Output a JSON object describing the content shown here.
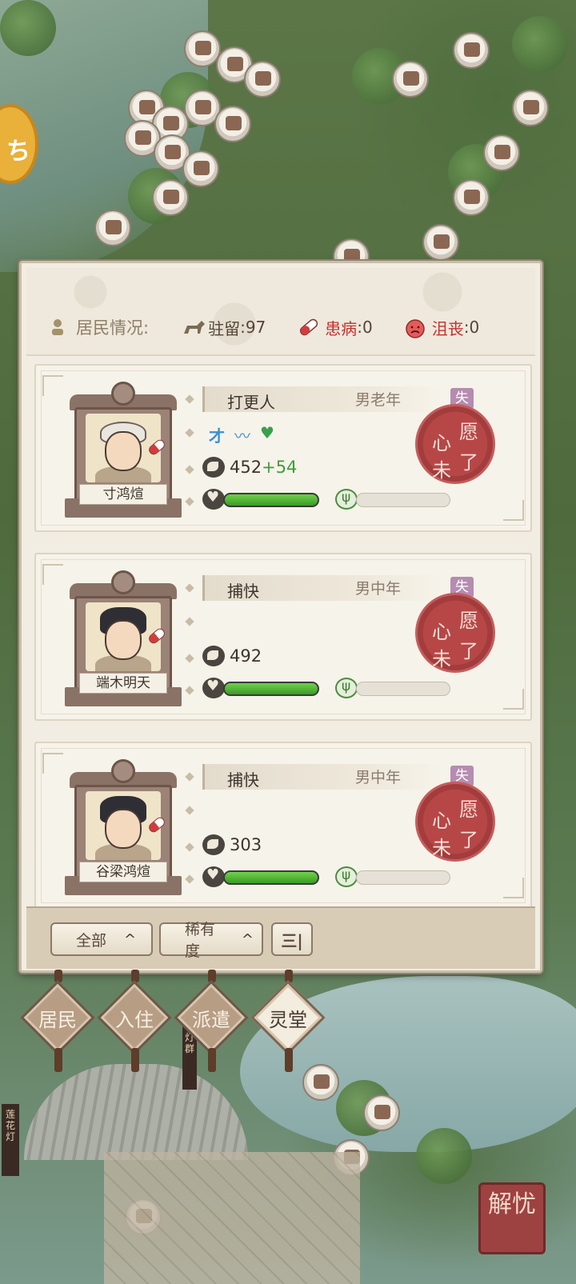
{
  "map": {
    "side_badge_glyph": "ち",
    "lamp_sign_text": "花灯群",
    "lamp_sign2_text": "莲花灯",
    "corner_button_label": "解忧"
  },
  "panel": {
    "header": {
      "residents_label": "居民情况:",
      "stationed_label": "驻留",
      "stationed_value": ":97",
      "sick_label": "患病",
      "sick_value": ":0",
      "frustrated_label": "沮丧",
      "frustrated_value": ":0"
    },
    "residents": [
      {
        "name": "寸鸿煊",
        "job": "打更人",
        "gender_age": "男老年",
        "badge": "失眠",
        "talent_1": "才",
        "talent_2": "〰",
        "talent_3": "♥",
        "power": "452",
        "power_bonus": "+54",
        "hp_fraction": 1.0,
        "xp_fraction": 0.0,
        "seal_1": "愿",
        "seal_2": "了",
        "seal_3": "心",
        "seal_4": "未",
        "portrait": "old-man"
      },
      {
        "name": "端木明天",
        "job": "捕快",
        "gender_age": "男中年",
        "badge": "失眠",
        "power": "492",
        "power_bonus": "",
        "hp_fraction": 1.0,
        "xp_fraction": 0.0,
        "seal_1": "愿",
        "seal_2": "了",
        "seal_3": "心",
        "seal_4": "未",
        "portrait": "constable"
      },
      {
        "name": "谷梁鸿煊",
        "job": "捕快",
        "gender_age": "男中年",
        "badge": "失眠",
        "power": "303",
        "power_bonus": "",
        "hp_fraction": 1.0,
        "xp_fraction": 0.0,
        "seal_1": "愿",
        "seal_2": "了",
        "seal_3": "心",
        "seal_4": "未",
        "portrait": "constable"
      }
    ],
    "footer": {
      "filter_all": "全部",
      "filter_rarity": "稀有度",
      "sort_order_glyph": "三|",
      "caret": "^"
    }
  },
  "tabs": [
    {
      "label": "居民",
      "active": false
    },
    {
      "label": "入住",
      "active": false
    },
    {
      "label": "派遣",
      "active": false
    },
    {
      "label": "灵堂",
      "active": true
    }
  ],
  "colors": {
    "panel_bg": "#f1ede2",
    "seal_red": "#b74747",
    "badge_purple": "#b68cb0",
    "hp_green": "#4fb832"
  },
  "icons": {
    "resident": "resident-icon",
    "horse": "horse-icon",
    "pill": "pill-icon",
    "sad": "sad-face-icon",
    "power": "power-icon",
    "heart": "heart-icon",
    "sprout": "sprout-icon"
  }
}
